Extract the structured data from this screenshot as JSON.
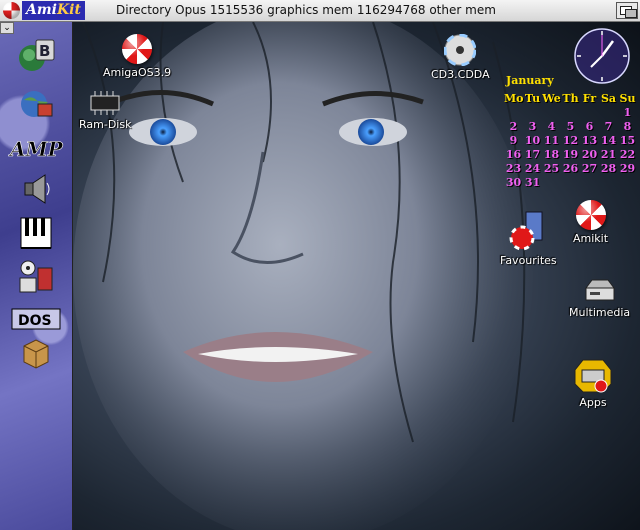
{
  "titlebar": {
    "logo_a": "Ami",
    "logo_b": "Kit",
    "text": "Directory Opus  1515536 graphics mem  116294768 other mem"
  },
  "dock": {
    "handle": "⌄",
    "items": [
      {
        "name": "dock-b-icon"
      },
      {
        "name": "dock-globe-icon"
      },
      {
        "name": "dock-amp-icon",
        "label": "AMP"
      },
      {
        "name": "dock-speaker-icon"
      },
      {
        "name": "dock-piano-icon"
      },
      {
        "name": "dock-tools-icon"
      },
      {
        "name": "dock-dos-icon",
        "label": "DOS"
      },
      {
        "name": "dock-box-icon"
      }
    ]
  },
  "desktop": {
    "icons": {
      "amigaos": "AmigaOS3.9",
      "ramdisk": "Ram-Disk",
      "cd": "CD3.CDDA",
      "favourites": "Favourites",
      "amikit": "Amikit",
      "multimedia": "Multimedia",
      "apps": "Apps"
    }
  },
  "calendar": {
    "month": "January",
    "headers": [
      "Mo",
      "Tu",
      "We",
      "Th",
      "Fr",
      "Sa",
      "Su"
    ],
    "days": [
      "",
      "",
      "",
      "",
      "",
      "",
      "1",
      "2",
      "3",
      "4",
      "5",
      "6",
      "7",
      "8",
      "9",
      "10",
      "11",
      "12",
      "13",
      "14",
      "15",
      "16",
      "17",
      "18",
      "19",
      "20",
      "21",
      "22",
      "23",
      "24",
      "25",
      "26",
      "27",
      "28",
      "29",
      "30",
      "31"
    ]
  },
  "colors": {
    "calendar_days": "#f060f0",
    "calendar_head": "#ffe000",
    "clock_face": "#3a2a8a"
  }
}
